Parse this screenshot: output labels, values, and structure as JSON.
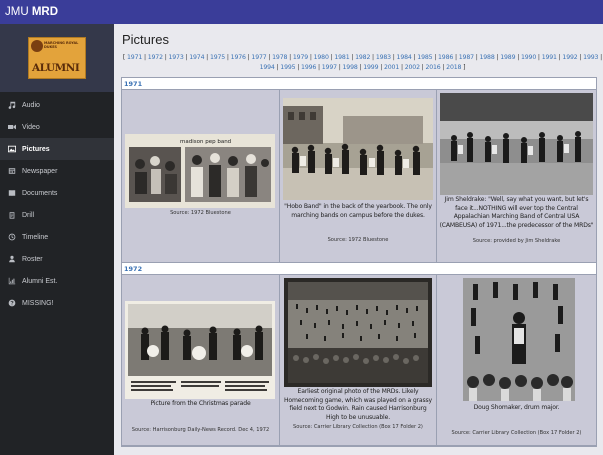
{
  "brand": {
    "prefix": "JMU",
    "name": "MRD"
  },
  "logo": {
    "small_text": "MARCHING ROYAL DUKES",
    "big_text": "ALUMNI"
  },
  "nav": [
    {
      "label": "Audio",
      "icon": "music-note-icon"
    },
    {
      "label": "Video",
      "icon": "video-camera-icon"
    },
    {
      "label": "Pictures",
      "icon": "image-icon",
      "active": true
    },
    {
      "label": "Newspaper",
      "icon": "newspaper-icon"
    },
    {
      "label": "Documents",
      "icon": "book-icon"
    },
    {
      "label": "Drill",
      "icon": "clipboard-icon"
    },
    {
      "label": "Timeline",
      "icon": "clock-icon"
    },
    {
      "label": "Roster",
      "icon": "user-icon"
    },
    {
      "label": "Alumni Est.",
      "icon": "bar-chart-icon"
    },
    {
      "label": "MISSING!",
      "icon": "question-circle-icon"
    }
  ],
  "page_title": "Pictures",
  "years": [
    "1971",
    "1972",
    "1973",
    "1974",
    "1975",
    "1976",
    "1977",
    "1978",
    "1979",
    "1980",
    "1981",
    "1982",
    "1983",
    "1984",
    "1985",
    "1986",
    "1987",
    "1988",
    "1989",
    "1990",
    "1991",
    "1992",
    "1993",
    "1994",
    "1995",
    "1996",
    "1997",
    "1998",
    "1999",
    "2001",
    "2002",
    "2016",
    "2018"
  ],
  "sections": [
    {
      "year": "1971",
      "items": [
        {
          "photo_title": "madison pep band",
          "caption": "",
          "source": "Source: 1972 Bluestone"
        },
        {
          "caption": "\"Hobo Band\" in the back of the yearbook. The only marching bands on campus before the dukes.",
          "source": "Source: 1972 Bluestone"
        },
        {
          "caption": "Jim Sheldrake: \"Well, say what you want, but let's face it...NOTHING will ever top the Central Appalachian Marching Band of Central USA (CAMBEUSA) of 1971...the predecessor of the MRDs\"",
          "source": "Source: provided by Jim Sheldrake"
        }
      ]
    },
    {
      "year": "1972",
      "items": [
        {
          "caption": "Picture from the Christmas parade",
          "source": "Source: Harrisonburg Daily-News Record. Dec 4, 1972"
        },
        {
          "caption": "Earliest original photo of the MRDs. Likely Homecoming game, which was played on a grassy field next to Godwin. Rain caused Harrisonburg High to be unusuable.",
          "source": "Source: Carrier Library Collection (Box 17 Folder 2)"
        },
        {
          "caption": "Doug Shomaker, drum major.",
          "source": "Source: Carrier Library Collection (Box 17 Folder 2)"
        }
      ]
    }
  ]
}
